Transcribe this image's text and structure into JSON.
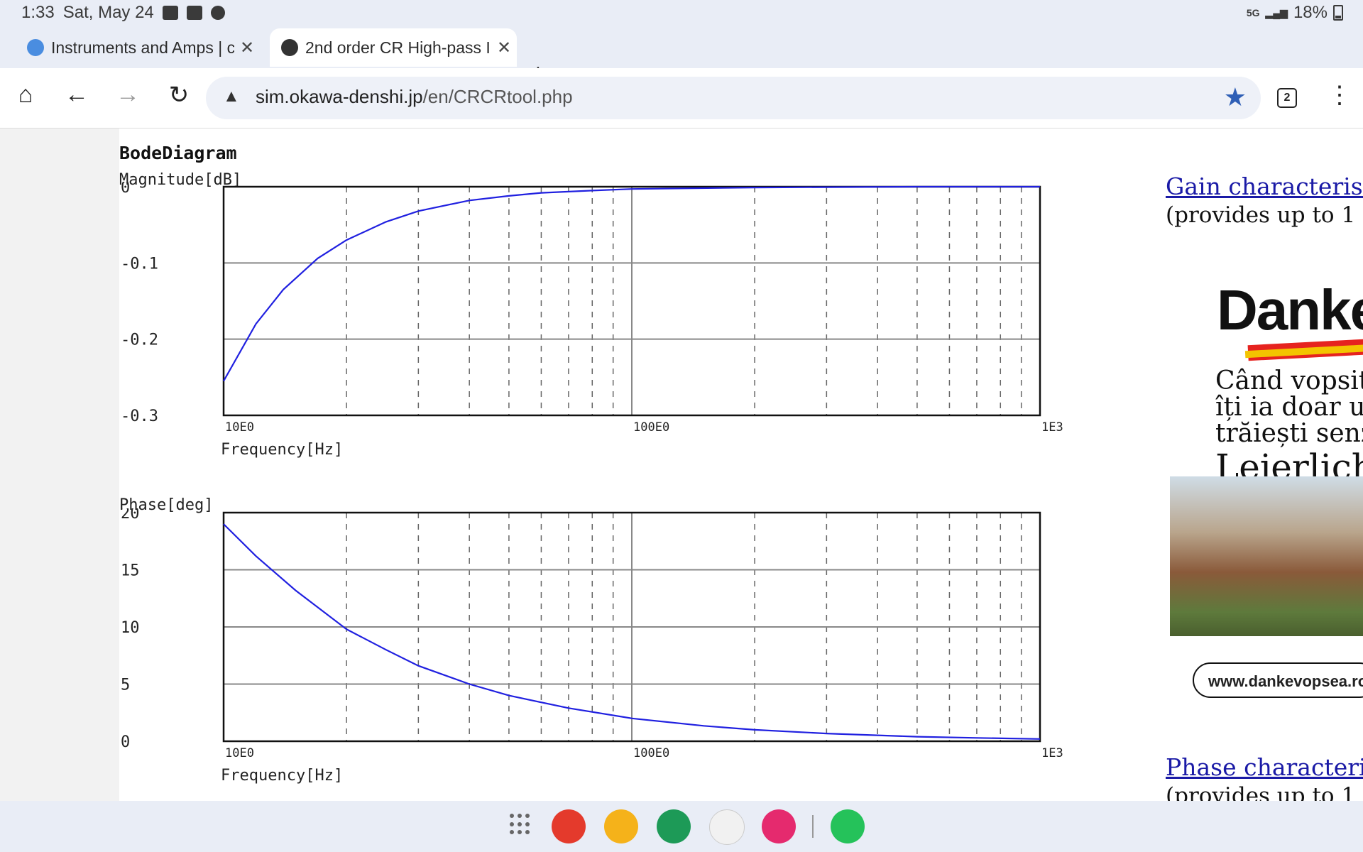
{
  "status_bar": {
    "time": "1:33",
    "date": "Sat, May 24",
    "network": "5G",
    "battery": "18%"
  },
  "tabs": [
    {
      "label": "Instruments and Amps | c",
      "favicon": "wave-icon",
      "active": false
    },
    {
      "label": "2nd order CR High-pass I",
      "favicon": "globe-icon",
      "active": true
    }
  ],
  "toolbar": {
    "url_host": "sim.okawa-denshi.jp",
    "url_path": "/en/CRCRtool.php",
    "tab_count": "2"
  },
  "content": {
    "title": "BodeDiagram",
    "gain_link": "Gain characteristics",
    "gain_note": "(provides up to 1",
    "phase_link": "Phase characteristics",
    "phase_note": "(provides up to 1"
  },
  "ad": {
    "brand": "Danke",
    "line1": "Când vopsitu",
    "line2": "îți ia doar un p",
    "line3": "trăiești senzat",
    "line4": "Lejerlich",
    "url": "www.dankevopsea.ro"
  },
  "chart_data": [
    {
      "type": "line",
      "title": "BodeDiagram",
      "ylabel": "Magnitude[dB]",
      "xlabel": "Frequency[Hz]",
      "x_scale": "log",
      "xlim": [
        10,
        1000
      ],
      "ylim": [
        -0.3,
        0
      ],
      "x_ticks": [
        "10E0",
        "100E0",
        "1E3"
      ],
      "y_ticks": [
        "0",
        "-0.1",
        "-0.2",
        "-0.3"
      ],
      "grid": true,
      "series": [
        {
          "x": [
            10,
            12,
            14,
            17,
            20,
            25,
            30,
            40,
            50,
            60,
            80,
            100,
            200,
            500,
            1000
          ],
          "y": [
            -0.255,
            -0.18,
            -0.135,
            -0.094,
            -0.07,
            -0.046,
            -0.032,
            -0.018,
            -0.012,
            -0.008,
            -0.005,
            -0.003,
            -0.001,
            0,
            0
          ]
        }
      ]
    },
    {
      "type": "line",
      "ylabel": "Phase[deg]",
      "xlabel": "Frequency[Hz]",
      "x_scale": "log",
      "xlim": [
        10,
        1000
      ],
      "ylim": [
        0,
        20
      ],
      "x_ticks": [
        "10E0",
        "100E0",
        "1E3"
      ],
      "y_ticks": [
        "20",
        "15",
        "10",
        "5",
        "0"
      ],
      "grid": true,
      "series": [
        {
          "x": [
            10,
            12,
            15,
            20,
            25,
            30,
            40,
            50,
            70,
            100,
            150,
            200,
            300,
            500,
            700,
            1000
          ],
          "y": [
            19,
            16.2,
            13.2,
            9.8,
            8,
            6.6,
            5,
            4,
            2.9,
            2,
            1.35,
            1,
            0.68,
            0.4,
            0.29,
            0.2
          ]
        }
      ]
    }
  ]
}
